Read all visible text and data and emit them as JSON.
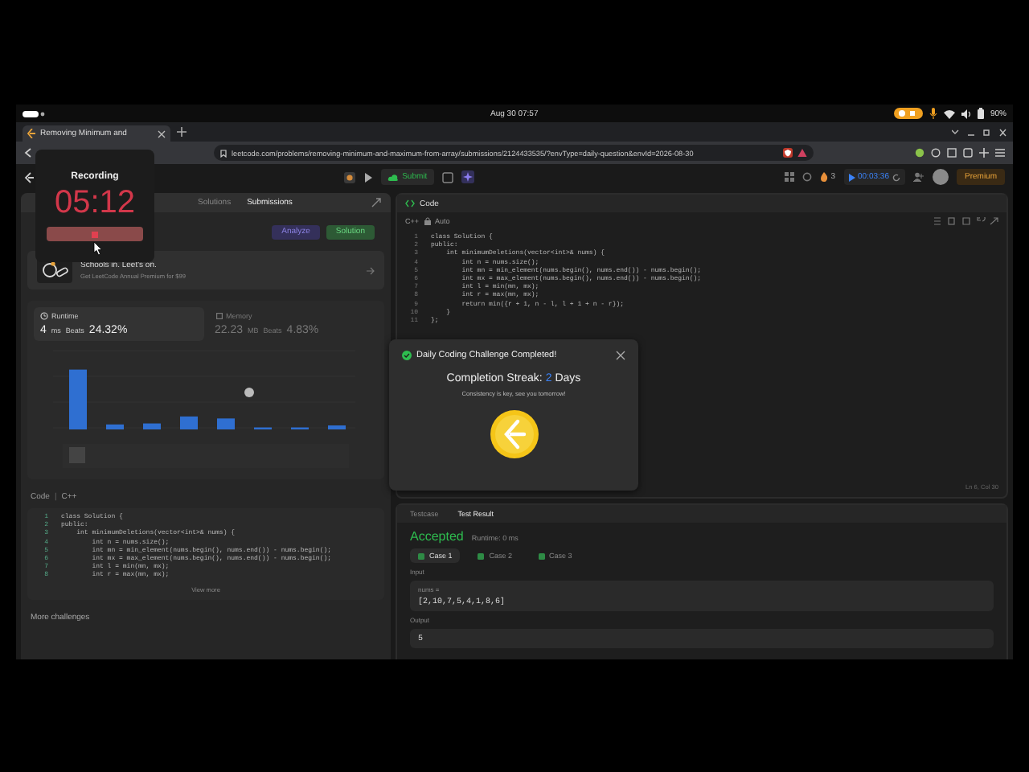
{
  "system_bar": {
    "date_time": "Aug 30  07:57",
    "battery": "90%"
  },
  "browser": {
    "tab_title": "Removing Minimum and",
    "url": "leetcode.com/problems/removing-minimum-and-maximum-from-array/submissions/2124433535/?envType=daily-question&envId=2026-08-30"
  },
  "toolbar": {
    "submit_label": "Submit",
    "streak_count": "3",
    "timer": "00:03:36",
    "premium_label": "Premium"
  },
  "left_panel": {
    "tabs": [
      {
        "label": "Solutions",
        "selected": false
      },
      {
        "label": "Submissions",
        "selected": true
      }
    ],
    "analyze_label": "Analyze",
    "solution_label": "Solution",
    "banner": {
      "title": "Schools in. Leet's on.",
      "subtitle": "Get LeetCode Annual Premium for $99"
    },
    "stats": [
      {
        "kind": "runtime",
        "label": "Runtime",
        "value": "4",
        "unit": "ms",
        "beats_label": "Beats",
        "beats": "24.32%",
        "selected": true
      },
      {
        "kind": "memory",
        "label": "Memory",
        "value": "22.23",
        "unit": "MB",
        "beats_label": "Beats",
        "beats": "4.83%",
        "selected": false
      }
    ],
    "code_title": "Code",
    "code_separator": "|",
    "code_language": "C++",
    "code_lines": [
      {
        "number": "1",
        "text": "class Solution {"
      },
      {
        "number": "2",
        "text": "public:"
      },
      {
        "number": "3",
        "text": "    int minimumDeletions(vector<int>& nums) {"
      },
      {
        "number": "4",
        "text": "        int n = nums.size();"
      },
      {
        "number": "5",
        "text": "        int mn = min_element(nums.begin(), nums.end()) - nums.begin();"
      },
      {
        "number": "6",
        "text": "        int mx = max_element(nums.begin(), nums.end()) - nums.begin();"
      },
      {
        "number": "7",
        "text": "        int l = min(mn, mx);"
      },
      {
        "number": "8",
        "text": "        int r = max(mn, mx);"
      }
    ],
    "view_more": "View more",
    "more_challenges": "More challenges"
  },
  "recording": {
    "title": "Recording",
    "time": "05:12"
  },
  "editor": {
    "title": "Code",
    "language": "C++",
    "mode": "Auto",
    "lines": [
      {
        "number": "1",
        "text": "class Solution {"
      },
      {
        "number": "2",
        "text": "public:"
      },
      {
        "number": "3",
        "text": "    int minimumDeletions(vector<int>& nums) {"
      },
      {
        "number": "4",
        "text": "        int n = nums.size();"
      },
      {
        "number": "5",
        "text": "        int mn = min_element(nums.begin(), nums.end()) - nums.begin();"
      },
      {
        "number": "6",
        "text": "        int mx = max_element(nums.begin(), nums.end()) - nums.begin();"
      },
      {
        "number": "7",
        "text": "        int l = min(mn, mx);"
      },
      {
        "number": "8",
        "text": "        int r = max(mn, mx);"
      },
      {
        "number": "9",
        "text": "        return min({r + 1, n - l, l + 1 + n - r});"
      },
      {
        "number": "10",
        "text": "    }"
      },
      {
        "number": "11",
        "text": "};"
      }
    ],
    "cursor_position": "Ln 6, Col 30"
  },
  "modal": {
    "title": "Daily Coding Challenge Completed!",
    "streak_label": "Completion Streak:",
    "streak_value": "2",
    "streak_unit": "Days",
    "message": "Consistency is key, see you tomorrow!"
  },
  "test_panel": {
    "tabs": [
      {
        "label": "Testcase",
        "selected": false
      },
      {
        "label": "Test Result",
        "selected": true
      }
    ],
    "status": "Accepted",
    "runtime": "Runtime: 0 ms",
    "cases": [
      {
        "label": "Case 1",
        "selected": true
      },
      {
        "label": "Case 2",
        "selected": false
      },
      {
        "label": "Case 3",
        "selected": false
      }
    ],
    "input_label": "Input",
    "param_label": "nums =",
    "param_value": "[2,10,7,5,4,1,8,6]",
    "output_label": "Output",
    "output_value": "5"
  }
}
